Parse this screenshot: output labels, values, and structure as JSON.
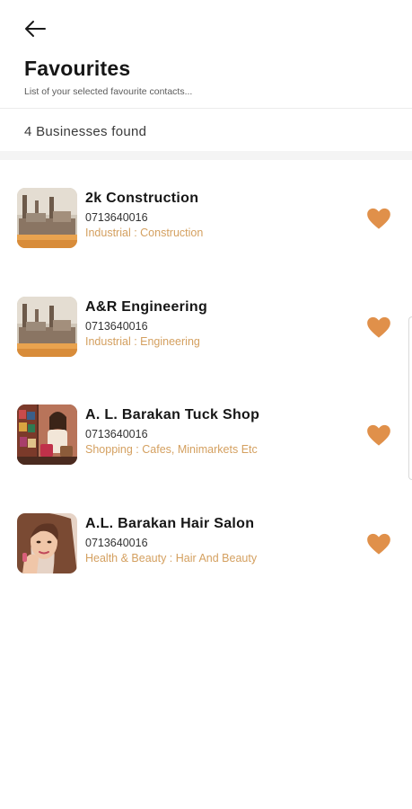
{
  "header": {
    "back_icon": "arrow-left-icon",
    "title": "Favourites",
    "subtitle": "List of your selected favourite contacts..."
  },
  "summary": {
    "count_text": "4 Businesses found"
  },
  "colors": {
    "accent": "#e0904a",
    "category_text": "#d4a060"
  },
  "businesses": [
    {
      "name": "2k Construction",
      "phone": "0713640016",
      "category": "Industrial : Construction",
      "thumbnail": "industrial-plant-image",
      "favourite_icon": "heart-icon"
    },
    {
      "name": "A&R Engineering",
      "phone": "0713640016",
      "category": "Industrial : Engineering",
      "thumbnail": "industrial-plant-image",
      "favourite_icon": "heart-icon"
    },
    {
      "name": "A. L. Barakan Tuck Shop",
      "phone": "0713640016",
      "category": "Shopping : Cafes, Minimarkets Etc",
      "thumbnail": "shopping-image",
      "favourite_icon": "heart-icon"
    },
    {
      "name": "A.L. Barakan Hair Salon",
      "phone": "0713640016",
      "category": "Health & Beauty : Hair And Beauty",
      "thumbnail": "beauty-portrait-image",
      "favourite_icon": "heart-icon"
    }
  ]
}
